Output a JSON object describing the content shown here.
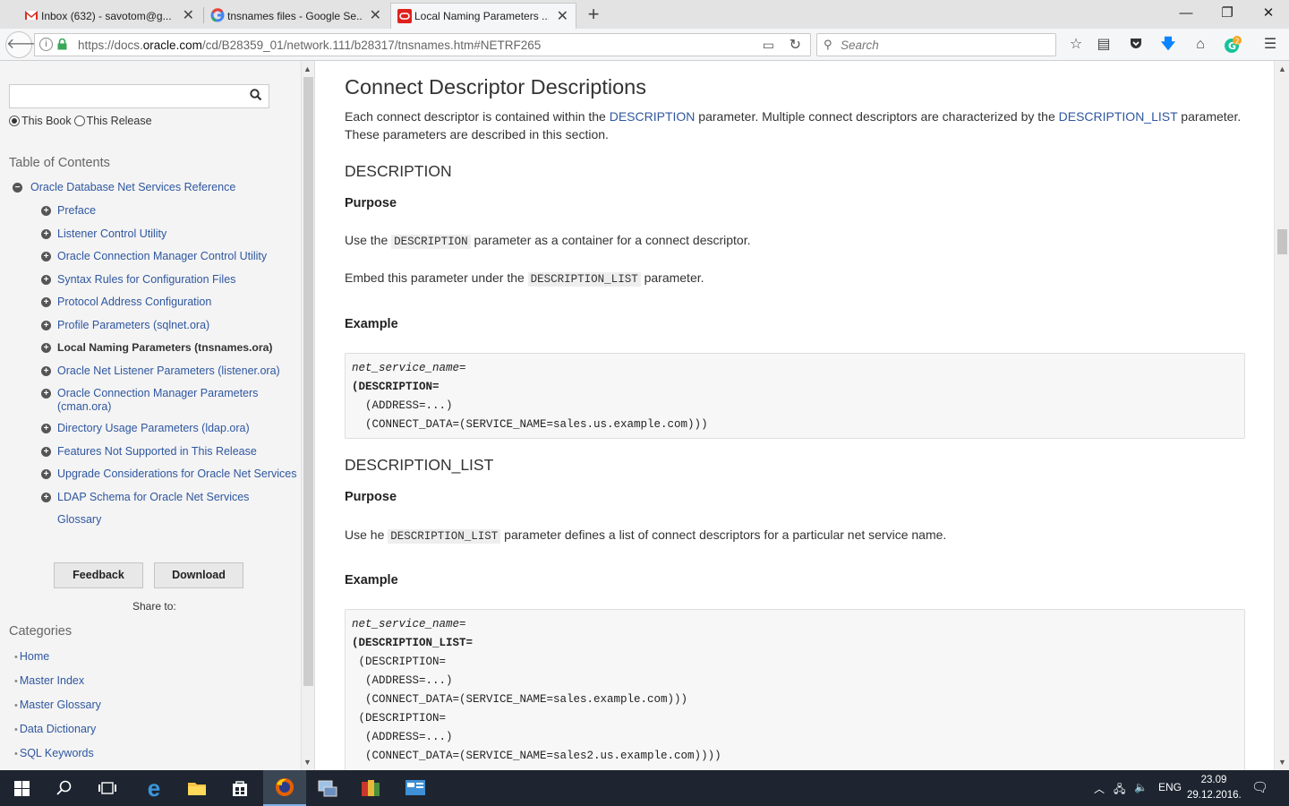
{
  "browser": {
    "tabs": [
      {
        "title": "Inbox (632) - savotom@g...",
        "icon": "gmail-icon"
      },
      {
        "title": "tnsnames files - Google Se...",
        "icon": "google-icon"
      },
      {
        "title": "Local Naming Parameters ...",
        "icon": "oracle-icon",
        "active": true
      }
    ],
    "url_prefix": "https://docs.",
    "url_domain": "oracle.com",
    "url_suffix": "/cd/B28359_01/network.111/b28317/tnsnames.htm#NETRF265",
    "search_placeholder": "Search",
    "download_badge": "2"
  },
  "sidebar": {
    "scope_this_book": "This Book",
    "scope_this_release": "This Release",
    "toc_heading": "Table of Contents",
    "toc_root": "Oracle Database Net Services Reference",
    "toc_items": [
      "Preface",
      "Listener Control Utility",
      "Oracle Connection Manager Control Utility",
      "Syntax Rules for Configuration Files",
      "Protocol Address Configuration",
      "Profile Parameters (sqlnet.ora)",
      "Local Naming Parameters (tnsnames.ora)",
      "Oracle Net Listener Parameters (listener.ora)",
      "Oracle Connection Manager Parameters (cman.ora)",
      "Directory Usage Parameters (ldap.ora)",
      "Features Not Supported in This Release",
      "Upgrade Considerations for Oracle Net Services",
      "LDAP Schema for Oracle Net Services",
      "Glossary"
    ],
    "feedback_label": "Feedback",
    "download_label": "Download",
    "share_label": "Share to:",
    "categories_heading": "Categories",
    "categories": [
      "Home",
      "Master Index",
      "Master Glossary",
      "Data Dictionary",
      "SQL Keywords"
    ]
  },
  "content": {
    "title": "Connect Descriptor Descriptions",
    "intro_1": "Each connect descriptor is contained within the ",
    "intro_link_1": "DESCRIPTION",
    "intro_2": " parameter. Multiple connect descriptors are characterized by the ",
    "intro_link_2": "DESCRIPTION_LIST",
    "intro_3": " parameter. These parameters are described in this section.",
    "sec1_title": "DESCRIPTION",
    "sec1_purpose": "Purpose",
    "sec1_p1_a": "Use the ",
    "sec1_p1_code": "DESCRIPTION",
    "sec1_p1_b": " parameter as a container for a connect descriptor.",
    "sec1_p2_a": "Embed this parameter under the ",
    "sec1_p2_code": "DESCRIPTION_LIST",
    "sec1_p2_b": " parameter.",
    "sec1_example": "Example",
    "code1": {
      "line1": "net_service_name",
      "line1_eq": "=",
      "line2": "(DESCRIPTION=",
      "line3": "  (ADDRESS=...)",
      "line4": "  (CONNECT_DATA=(SERVICE_NAME=sales.us.example.com)))"
    },
    "sec2_title": "DESCRIPTION_LIST",
    "sec2_purpose": "Purpose",
    "sec2_p1_a": "Use he ",
    "sec2_p1_code": "DESCRIPTION_LIST",
    "sec2_p1_b": " parameter defines a list of connect descriptors for a particular net service name.",
    "sec2_example": "Example",
    "code2": {
      "line1": "net_service_name",
      "line1_eq": "=",
      "line2": "(DESCRIPTION_LIST=",
      "line3": " (DESCRIPTION=",
      "line4": "  (ADDRESS=...)",
      "line5": "  (CONNECT_DATA=(SERVICE_NAME=sales.example.com)))",
      "line6": " (DESCRIPTION=",
      "line7": "  (ADDRESS=...)",
      "line8": "  (CONNECT_DATA=(SERVICE_NAME=sales2.us.example.com))))"
    }
  },
  "taskbar": {
    "lang": "ENG",
    "time": "23.09",
    "date": "29.12.2016."
  }
}
